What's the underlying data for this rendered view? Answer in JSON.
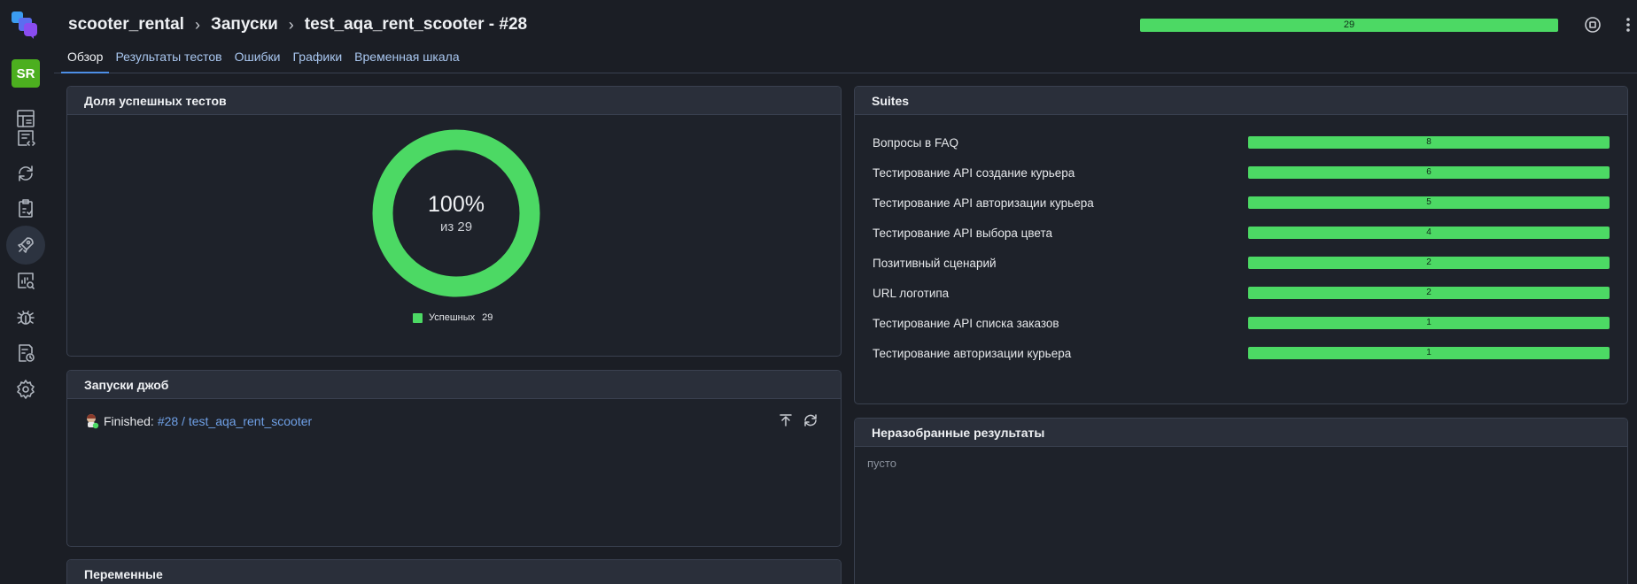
{
  "sidebar": {
    "avatar": "SR",
    "items": [
      "dashboard-icon",
      "code-review-icon",
      "sync-icon",
      "checklist-icon",
      "rocket-icon",
      "analytics-icon",
      "bug-icon",
      "scheduler-icon",
      "gear-icon"
    ],
    "active_item": "rocket-icon"
  },
  "header": {
    "breadcrumb": [
      "scooter_rental",
      "Запуски",
      "test_aqa_rent_scooter - #28"
    ],
    "progress_label": "29",
    "progress_fraction": 1.0,
    "tabs": [
      "Обзор",
      "Результаты тестов",
      "Ошибки",
      "Графики",
      "Временная шкала"
    ],
    "active_tab": 0
  },
  "success_panel": {
    "title": "Доля успешных тестов",
    "percent": "100%",
    "of_text": "из 29",
    "legend": [
      {
        "label": "Успешных",
        "count": "29",
        "color": "#4cd964"
      }
    ]
  },
  "jobs_panel": {
    "title": "Запуски джоб",
    "status": "Finished:",
    "link_text": "#28 / test_aqa_rent_scooter"
  },
  "variables_panel": {
    "title": "Переменные"
  },
  "suites_panel": {
    "title": "Suites",
    "rows": [
      {
        "name": "Вопросы в FAQ",
        "count": "8"
      },
      {
        "name": "Тестирование API создание курьера",
        "count": "6"
      },
      {
        "name": "Тестирование API авторизации курьера",
        "count": "5"
      },
      {
        "name": "Тестирование API выбора цвета",
        "count": "4"
      },
      {
        "name": "Позитивный сценарий",
        "count": "2"
      },
      {
        "name": "URL логотипа",
        "count": "2"
      },
      {
        "name": "Тестирование API списка заказов",
        "count": "1"
      },
      {
        "name": "Тестирование авторизации курьера",
        "count": "1"
      }
    ]
  },
  "unparsed_panel": {
    "title": "Неразобранные результаты",
    "empty_text": "пусто"
  },
  "colors": {
    "success": "#4cd964",
    "accent": "#4d8fe6",
    "link": "#6fa0e6"
  }
}
